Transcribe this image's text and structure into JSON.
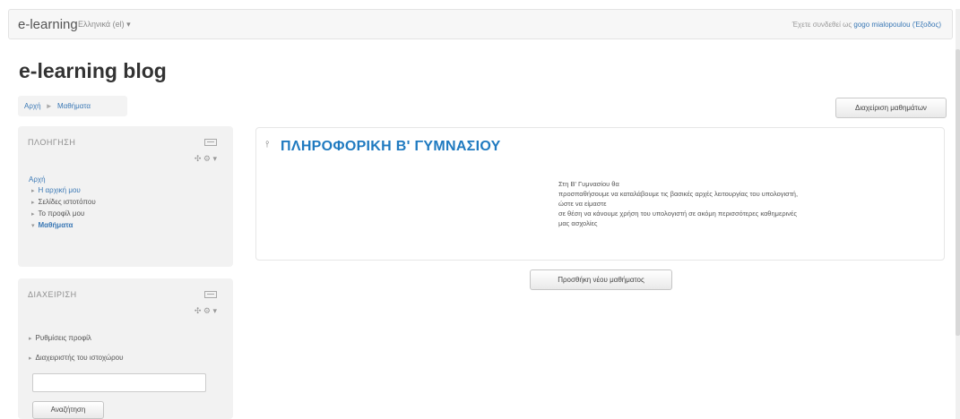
{
  "topbar": {
    "brand": "e-learning",
    "language": "Ελληνικά (el) ▾",
    "login_prefix": "Έχετε συνδεθεί ως",
    "user_name": "gogo mialopoulou",
    "logout_label": "(Έξοδος)"
  },
  "site_title": "e-learning blog",
  "breadcrumb": {
    "home": "Αρχή",
    "separator": "►",
    "current": "Μαθήματα"
  },
  "courses_button": "Διαχείριση μαθημάτων",
  "navigation": {
    "title": "ΠΛΟΗΓΗΣΗ",
    "controls": "✣ ⚙ ▾",
    "home": "Αρχή",
    "items": [
      {
        "label": "Η αρχική μου",
        "bullet": "▸"
      },
      {
        "label": "Σελίδες ιστοτόπου",
        "bullet": "▸"
      },
      {
        "label": "Το προφίλ μου",
        "bullet": "▸"
      },
      {
        "label": "Μαθήματα",
        "bullet": "▾"
      }
    ]
  },
  "administration": {
    "title": "ΔΙΑΧΕΙΡΙΣΗ",
    "controls": "✣ ⚙ ▾",
    "items": [
      {
        "label": "Ρυθμίσεις προφίλ",
        "bullet": "▸"
      },
      {
        "label": "Διαχειριστής του ιστοχώρου",
        "bullet": "▸"
      }
    ],
    "search_placeholder": "",
    "search_button": "Αναζήτηση"
  },
  "course": {
    "icon": "lightbulb-icon",
    "title": "ΠΛΗΡΟΦΟΡΙΚΗ Β' ΓΥΜΝΑΣΙΟΥ",
    "summary": [
      "Στη Β' Γυμνασίου θα",
      "προσπαθήσουμε να καταλάβουμε τις βασικές αρχές λειτουργίας του υπολογιστή,",
      "ώστε να είμαστε",
      "σε θέση να κάνουμε χρήση του υπολογιστή σε ακόμη περισσότερες καθημερινές",
      "μας ασχολίες"
    ]
  },
  "add_course_button": "Προσθήκη νέου μαθήματος",
  "colors": {
    "link": "#3a78b5",
    "course_title": "#1f7ac0",
    "block_bg": "#f2f2f2"
  }
}
